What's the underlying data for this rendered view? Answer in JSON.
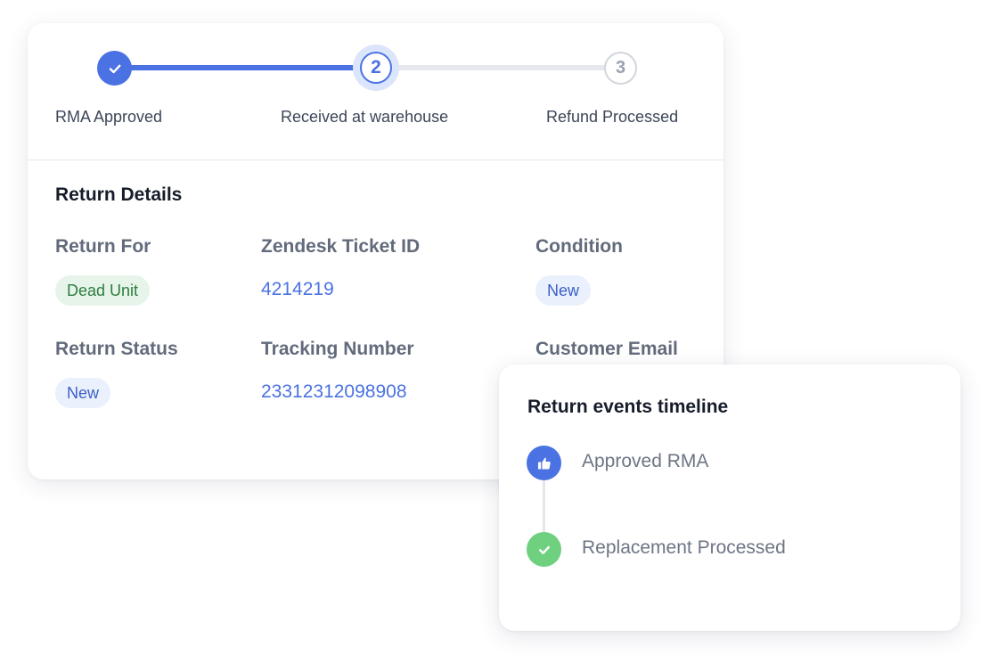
{
  "stepper": {
    "steps": [
      {
        "label": "RMA Approved",
        "status": "completed"
      },
      {
        "label": "Received at warehouse",
        "number": "2",
        "status": "current"
      },
      {
        "label": "Refund Processed",
        "number": "3",
        "status": "pending"
      }
    ]
  },
  "return_details": {
    "title": "Return Details",
    "return_for": {
      "label": "Return For",
      "value": "Dead Unit"
    },
    "zendesk_ticket": {
      "label": "Zendesk Ticket ID",
      "value": "4214219"
    },
    "condition": {
      "label": "Condition",
      "value": "New"
    },
    "return_status": {
      "label": "Return Status",
      "value": "New"
    },
    "tracking_number": {
      "label": "Tracking Number",
      "value": "23312312098908"
    },
    "customer_email": {
      "label": "Customer Email"
    }
  },
  "timeline": {
    "title": "Return events timeline",
    "events": [
      {
        "label": "Approved RMA",
        "icon": "thumbs-up-icon"
      },
      {
        "label": "Replacement Processed",
        "icon": "check-icon"
      }
    ]
  },
  "colors": {
    "primary": "#4a72e2",
    "success": "#6fd080",
    "badge_green_bg": "#e6f4ea",
    "badge_blue_bg": "#eaf0fc"
  }
}
